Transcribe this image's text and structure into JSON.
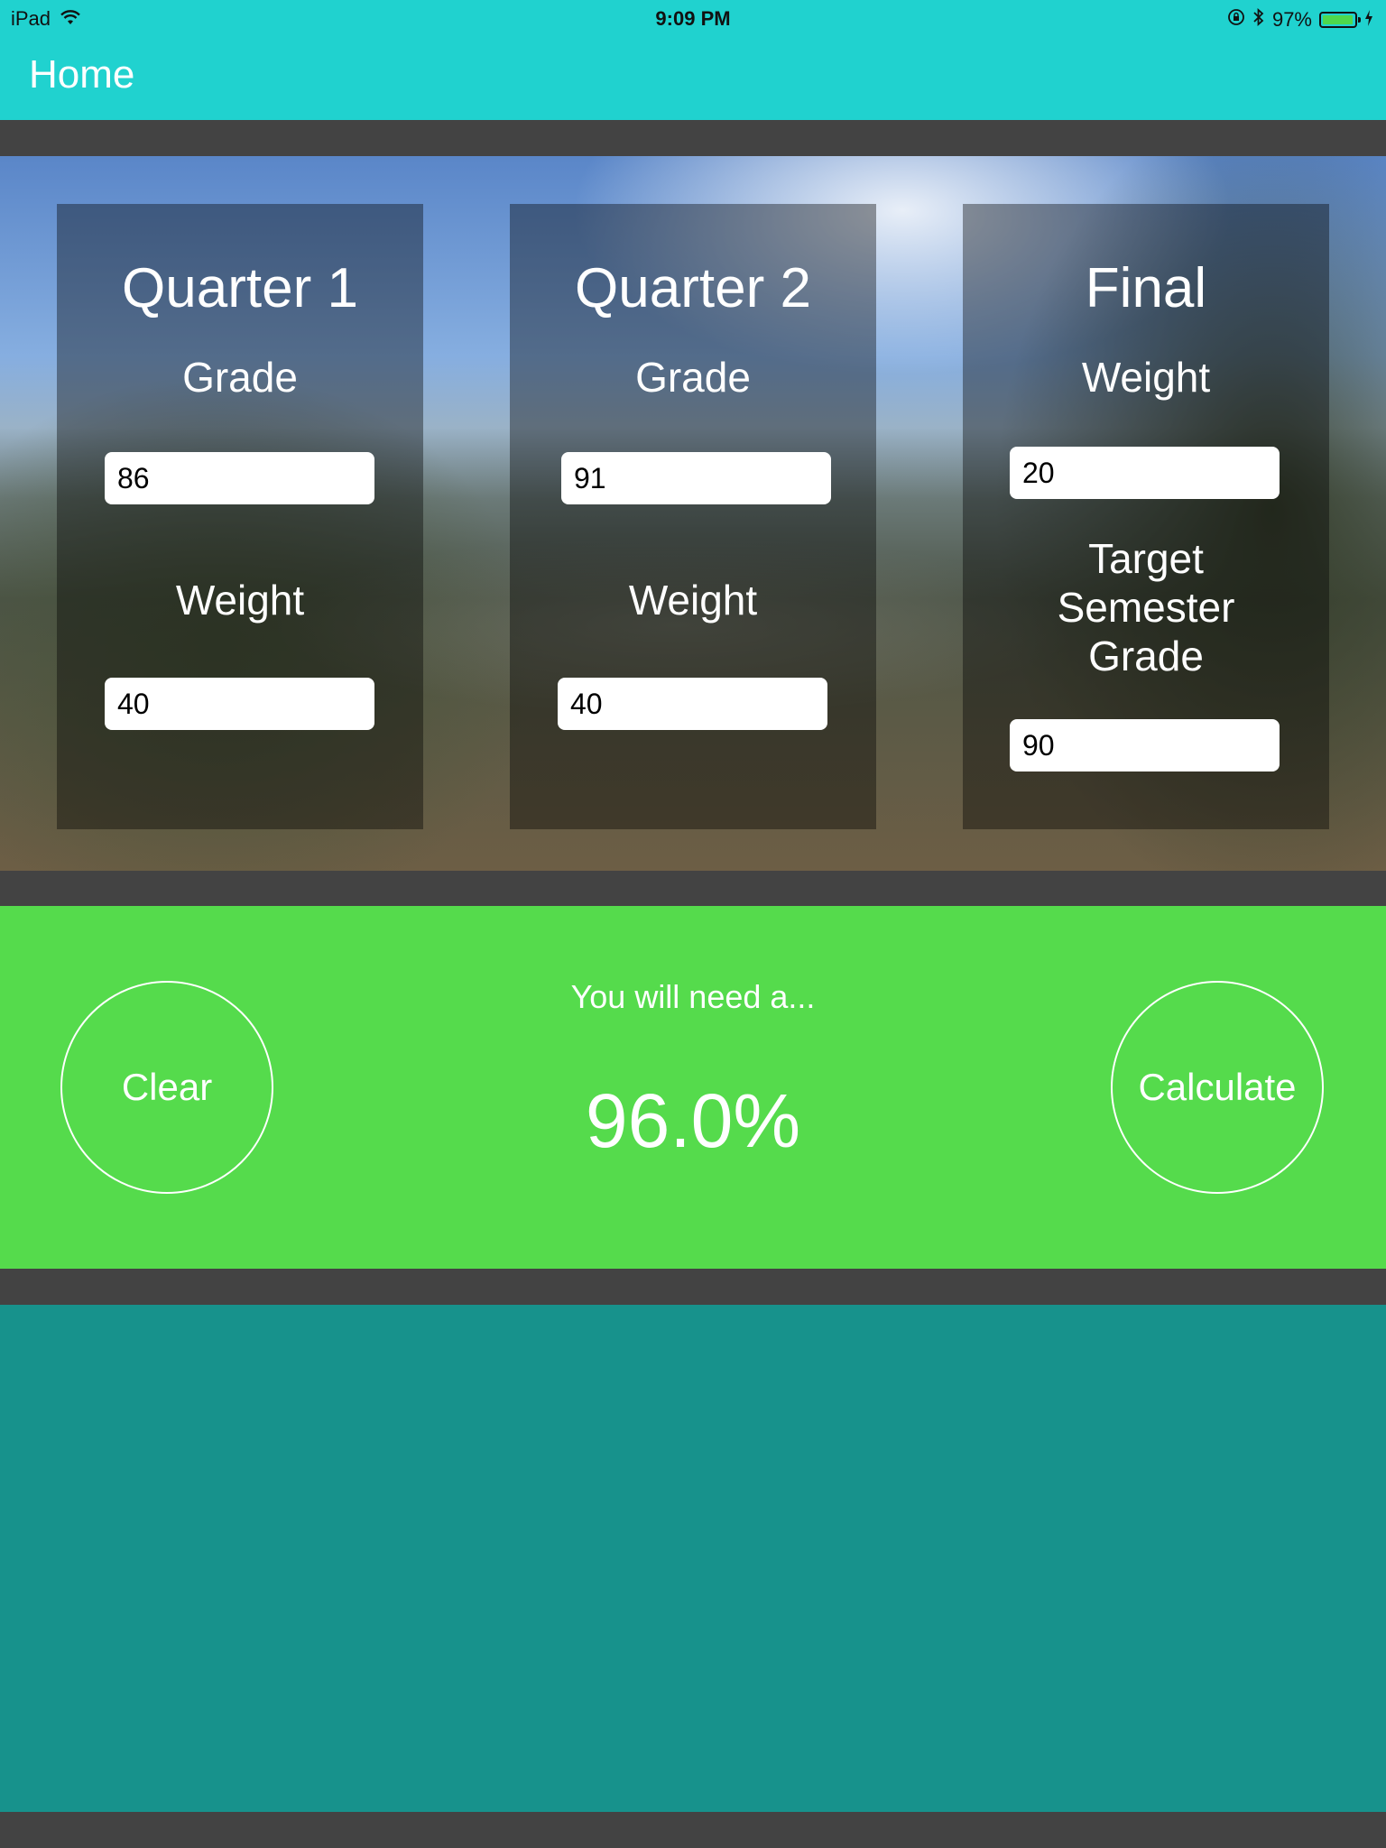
{
  "status_bar": {
    "device": "iPad",
    "time": "9:09 PM",
    "battery": "97%",
    "battery_level": 0.97
  },
  "nav": {
    "title": "Home"
  },
  "panels": {
    "quarter1": {
      "title": "Quarter 1",
      "grade_label": "Grade",
      "grade_value": "86",
      "weight_label": "Weight",
      "weight_value": "40"
    },
    "quarter2": {
      "title": "Quarter 2",
      "grade_label": "Grade",
      "grade_value": "91",
      "weight_label": "Weight",
      "weight_value": "40"
    },
    "final": {
      "title": "Final",
      "weight_label": "Weight",
      "weight_value": "20",
      "target_label": "Target Semester Grade",
      "target_value": "90"
    }
  },
  "result": {
    "clear_label": "Clear",
    "calculate_label": "Calculate",
    "need_text": "You will need a...",
    "value": "96.0%"
  },
  "colors": {
    "header": "#20D2CF",
    "result_bar": "#55DB4C",
    "bottom_area": "#17928C",
    "separator": "#434343"
  },
  "icons": {
    "wifi": "wifi-icon",
    "orientation_lock": "orientation-lock-icon",
    "bluetooth": "bluetooth-icon",
    "battery": "battery-icon",
    "charging": "charging-bolt-icon"
  }
}
